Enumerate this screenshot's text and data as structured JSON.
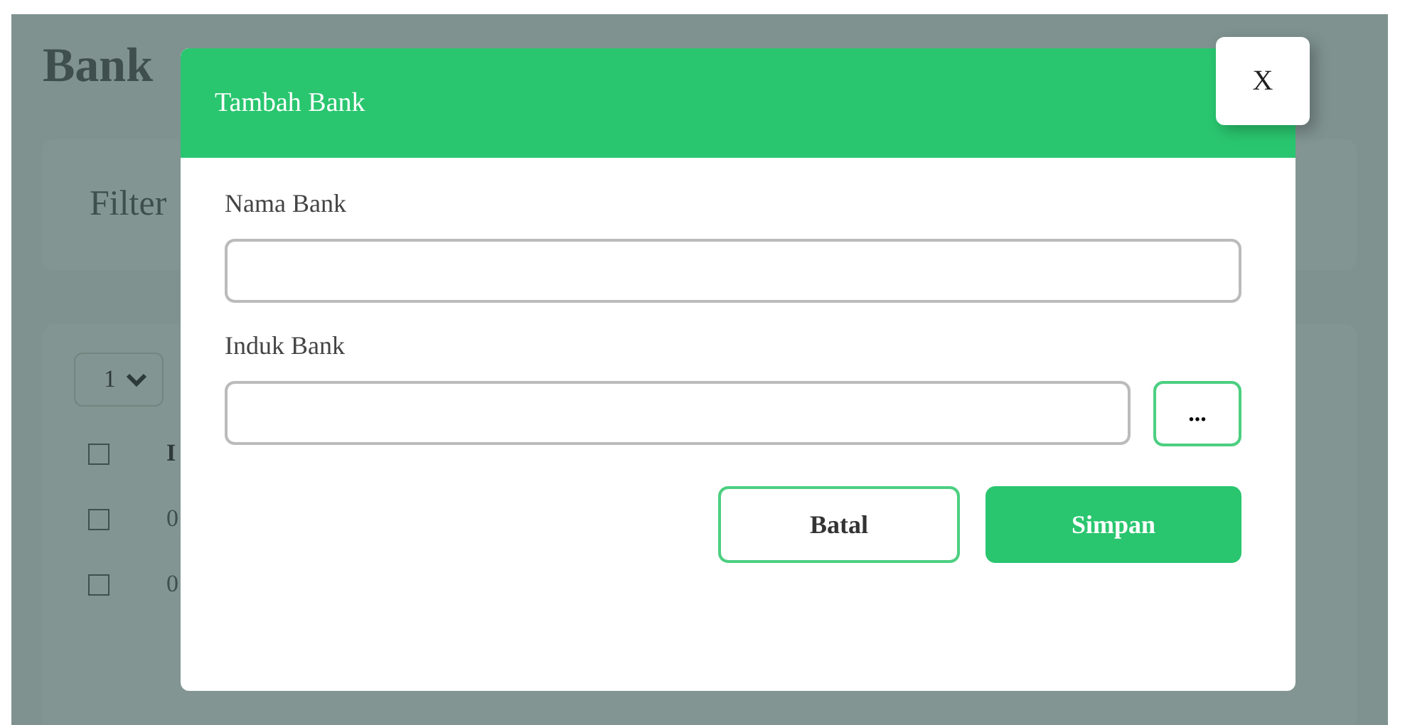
{
  "page": {
    "title": "Bank",
    "filter_label": "Filter",
    "page_size": "1",
    "table": {
      "header": {
        "checked": false,
        "column_1": "I"
      },
      "rows": [
        {
          "checked": false,
          "column_1": "0"
        },
        {
          "checked": false,
          "column_1": "0"
        }
      ]
    }
  },
  "modal": {
    "title": "Tambah Bank",
    "close": "X",
    "fields": [
      {
        "kind": "text",
        "label": "Nama Bank"
      },
      {
        "kind": "lookup",
        "label": "Induk Bank",
        "button": "..."
      }
    ],
    "buttons": [
      {
        "kind": "outline",
        "label": "Batal"
      },
      {
        "kind": "primary",
        "label": "Simpan"
      }
    ]
  }
}
